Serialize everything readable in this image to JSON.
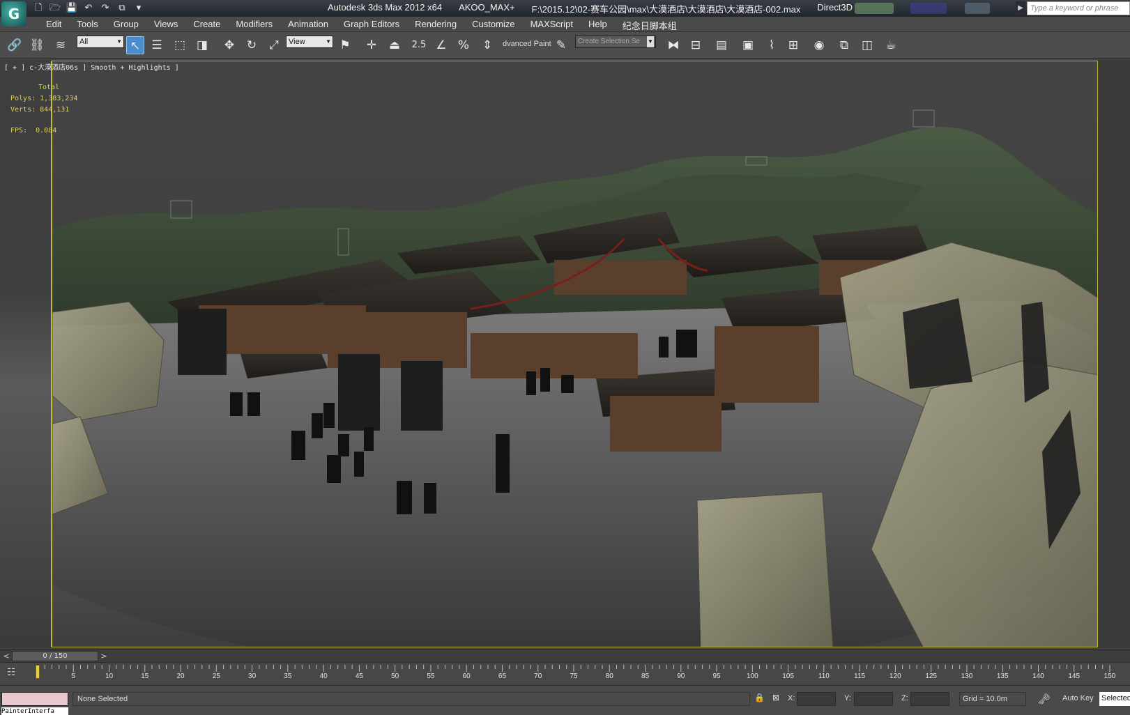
{
  "title_bar": {
    "app_name": "Autodesk 3ds Max  2012 x64",
    "workspace": "AKOO_MAX+",
    "file_path": "F:\\2015.12\\02-赛车公园\\max\\大漠酒店\\大漠酒店\\大漠酒店-002.max",
    "renderer": "Direct3D",
    "search_placeholder": "Type a keyword or phrase"
  },
  "quick_access": {
    "new": "🗋",
    "open": "🗁",
    "save": "💾",
    "undo": "↶",
    "redo": "↷",
    "project": "⧉",
    "more": "▾"
  },
  "menu": {
    "items": [
      "Edit",
      "Tools",
      "Group",
      "Views",
      "Create",
      "Modifiers",
      "Animation",
      "Graph Editors",
      "Rendering",
      "Customize",
      "MAXScript",
      "Help",
      "纪念日脚本组"
    ]
  },
  "toolbar": {
    "selection_filter": "All",
    "reference_coord": "View",
    "angle_snap": "2.5",
    "advanced_paint": "dvanced Paint",
    "selection_set_placeholder": "Create Selection Se"
  },
  "viewport": {
    "label": "[ + ] c-大漠酒店06s ] Smooth + Highlights ]",
    "stats_total": "Total",
    "polys_label": "Polys:",
    "polys_value": "1,383,234",
    "verts_label": "Verts:",
    "verts_value": "844,131",
    "fps_label": "FPS:",
    "fps_value": "0.084"
  },
  "timeline": {
    "frame_display": "0 / 150",
    "prev": "<",
    "next": ">",
    "tick_labels": [
      "5",
      "10",
      "15",
      "20",
      "25",
      "30",
      "35",
      "40",
      "45",
      "50",
      "55",
      "60",
      "65",
      "70",
      "75",
      "80",
      "85",
      "90",
      "95",
      "100",
      "105",
      "110",
      "115",
      "120",
      "125",
      "130",
      "135",
      "140",
      "145",
      "150"
    ]
  },
  "status": {
    "maxscript_listener": "PainterInterfa",
    "selection_info": "None Selected",
    "x_label": "X:",
    "y_label": "Y:",
    "z_label": "Z:",
    "grid": "Grid = 10.0m",
    "auto_key": "Auto Key",
    "key_mode": "Selected"
  }
}
